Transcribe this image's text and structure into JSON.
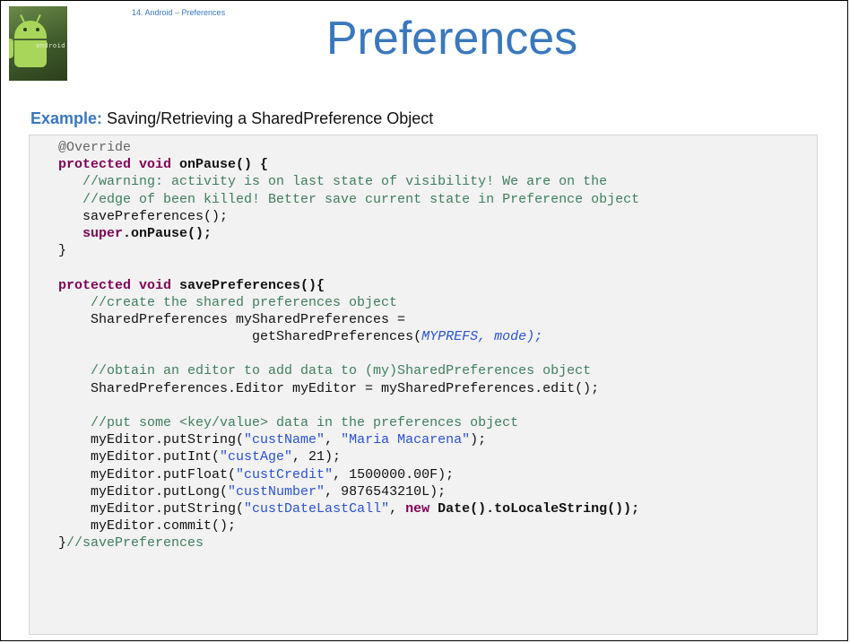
{
  "header": {
    "breadcrumb": "14. Android – Preferences",
    "title": "Preferences",
    "logo_text": "android"
  },
  "subtitle": {
    "lead": "Example:",
    "text": " Saving/Retrieving a SharedPreference Object"
  },
  "code": {
    "l01": "@Override",
    "l02_kw": "protected void",
    "l02_rest": " onPause() {",
    "l03": "   //warning: activity is on last state of visibility! We are on the",
    "l04": "   //edge of been killed! Better save current state in Preference object",
    "l05": "   savePreferences();",
    "l06_kw": "   super",
    "l06_rest": ".onPause();",
    "l07": "}",
    "l08": "",
    "l09_kw": "protected void",
    "l09_rest": " savePreferences(){",
    "l10": "    //create the shared preferences object",
    "l11": "    SharedPreferences mySharedPreferences =",
    "l12_pre": "                        getSharedPreferences(",
    "l12_a": "MYPREFS",
    "l12_b": ", mode);",
    "l13": "",
    "l14": "    //obtain an editor to add data to (my)SharedPreferences object",
    "l15": "    SharedPreferences.Editor myEditor = mySharedPreferences.edit();",
    "l16": "",
    "l17": "    //put some <key/value> data in the preferences object",
    "l18_a": "    myEditor.putString(",
    "l18_s1": "\"custName\"",
    "l18_b": ", ",
    "l18_s2": "\"Maria Macarena\"",
    "l18_c": ");",
    "l19_a": "    myEditor.putInt(",
    "l19_s": "\"custAge\"",
    "l19_b": ", 21);",
    "l20_a": "    myEditor.putFloat(",
    "l20_s": "\"custCredit\"",
    "l20_b": ", 1500000.00F);",
    "l21_a": "    myEditor.putLong(",
    "l21_s": "\"custNumber\"",
    "l21_b": ", 9876543210L);",
    "l22_a": "    myEditor.putString(",
    "l22_s": "\"custDateLastCall\"",
    "l22_b": ", ",
    "l22_kw": "new",
    "l22_c": " Date().toLocaleString());",
    "l23": "    myEditor.commit();",
    "l24_a": "}",
    "l24_cm": "//savePreferences"
  }
}
